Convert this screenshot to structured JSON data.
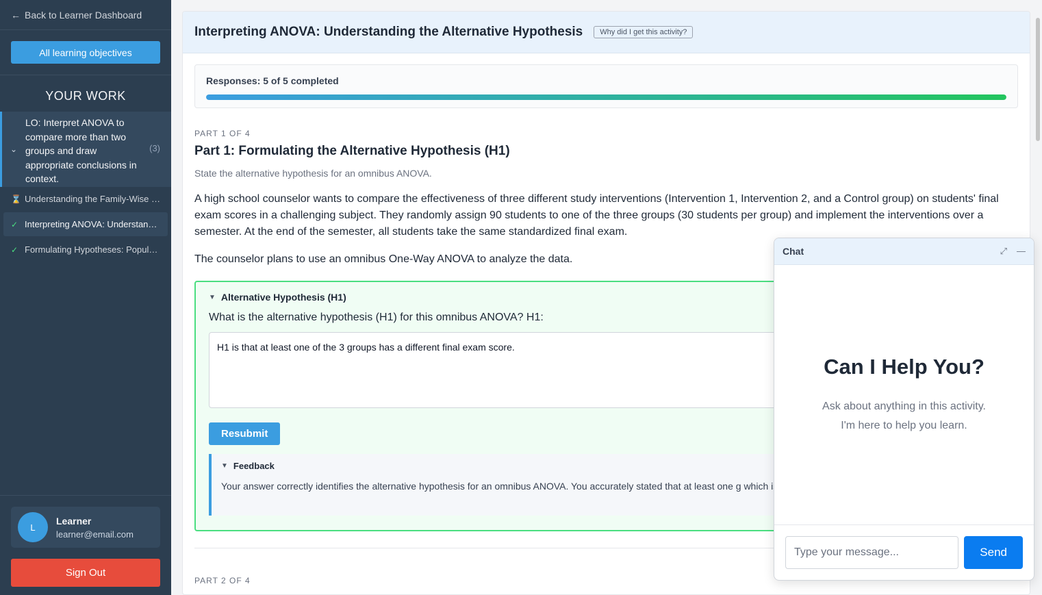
{
  "sidebar": {
    "back_label": "Back to Learner Dashboard",
    "all_objectives_label": "All learning objectives",
    "your_work_label": "YOUR WORK",
    "objective": {
      "text": "LO: Interpret ANOVA to compare more than two groups and draw appropriate conclusions in context.",
      "count": "(3)"
    },
    "activities": [
      {
        "label": "Understanding the Family-Wise Error Rate",
        "status": "in-progress"
      },
      {
        "label": "Interpreting ANOVA: Understanding the Alternative Hypothesis",
        "status": "complete"
      },
      {
        "label": "Formulating Hypotheses: Population Parameters",
        "status": "complete"
      }
    ],
    "user": {
      "initial": "L",
      "name": "Learner",
      "email": "learner@email.com"
    },
    "sign_out_label": "Sign Out"
  },
  "main": {
    "title": "Interpreting ANOVA: Understanding the Alternative Hypothesis",
    "why_label": "Why did I get this activity?",
    "progress": {
      "label": "Responses: 5 of 5 completed",
      "fraction": 1.0
    },
    "part1": {
      "label": "PART 1 OF 4",
      "title": "Part 1: Formulating the Alternative Hypothesis (H1)",
      "subtitle": "State the alternative hypothesis for an omnibus ANOVA.",
      "paragraph1": "A high school counselor wants to compare the effectiveness of three different study interventions (Intervention 1, Intervention 2, and a Control group) on students' final exam scores in a challenging subject. They randomly assign 90 students to one of the three groups (30 students per group) and implement the interventions over a semester. At the end of the semester, all students take the same standardized final exam.",
      "paragraph2": "The counselor plans to use an omnibus One-Way ANOVA to analyze the data.",
      "answer_heading": "Alternative Hypothesis (H1)",
      "question": "What is the alternative hypothesis (H1) for this omnibus ANOVA? H1:",
      "answer_value": "H1 is that at least one of the 3 groups has a different final exam score.",
      "resubmit_label": "Resubmit",
      "feedback_heading": "Feedback",
      "feedback_text": "Your answer correctly identifies the alternative hypothesis for an omnibus ANOVA. You accurately stated that at least one g which is the correct formulation."
    },
    "part2_label": "PART 2 OF 4"
  },
  "chat": {
    "title": "Chat",
    "heading": "Can I Help You?",
    "help_line1": "Ask about anything in this activity.",
    "help_line2": "I'm here to help you learn.",
    "input_placeholder": "Type your message...",
    "send_label": "Send"
  },
  "colors": {
    "sidebar_bg": "#2c3e50",
    "accent": "#3b9de0",
    "success": "#4ade80",
    "danger": "#e74c3c",
    "send": "#0a7cf0"
  }
}
